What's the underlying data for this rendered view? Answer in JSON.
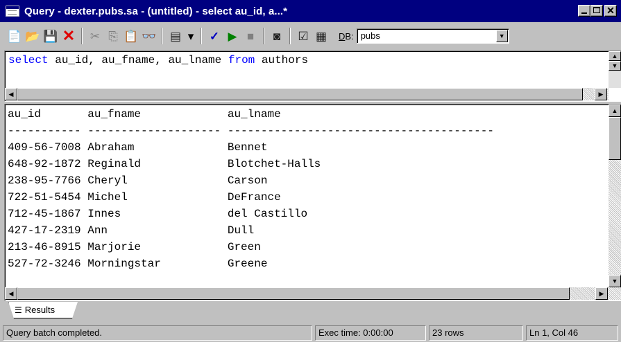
{
  "window": {
    "title": "Query - dexter.pubs.sa - (untitled) - select au_id, a...*",
    "min_glyph": "",
    "max_glyph": "",
    "close_glyph": "✕"
  },
  "toolbar": {
    "icons": {
      "new_query": "📄",
      "open_file": "📂",
      "save": "💾",
      "delete": "✕",
      "cut": "✂",
      "copy": "⎘",
      "paste": "📋",
      "find": "👓",
      "query_mode": "▤",
      "query_mode_dropdown": "▾",
      "parse": "✓",
      "execute": "▶",
      "cancel": "■",
      "display_plan": "◙",
      "options": "☑",
      "results_grid": "▦"
    },
    "db_label_accel": "D",
    "db_label_rest": "B:",
    "db_value": "pubs",
    "db_dropdown": "▼"
  },
  "editor": {
    "sql_parts": [
      {
        "text": "select",
        "keyword": true
      },
      {
        "text": " au_id, au_fname, au_lname ",
        "keyword": false
      },
      {
        "text": "from",
        "keyword": true
      },
      {
        "text": " authors",
        "keyword": false
      }
    ],
    "scroll_up": "▲",
    "scroll_down": "▼",
    "scroll_left": "◀",
    "scroll_right": "▶"
  },
  "results": {
    "lines": [
      "au_id       au_fname             au_lname",
      "----------- -------------------- ----------------------------------------",
      "409-56-7008 Abraham              Bennet",
      "648-92-1872 Reginald             Blotchet-Halls",
      "238-95-7766 Cheryl               Carson",
      "722-51-5454 Michel               DeFrance",
      "712-45-1867 Innes                del Castillo",
      "427-17-2319 Ann                  Dull",
      "213-46-8915 Marjorie             Green",
      "527-72-3246 Morningstar          Greene"
    ],
    "scroll_up": "▲",
    "scroll_down": "▼",
    "scroll_left": "◀",
    "scroll_right": "▶"
  },
  "tabs": {
    "results_icon": "☰",
    "results_label": "Results"
  },
  "status": {
    "message": "Query batch completed.",
    "exec_time": "Exec time: 0:00:00",
    "rows": "23 rows",
    "position": "Ln 1, Col 46"
  }
}
